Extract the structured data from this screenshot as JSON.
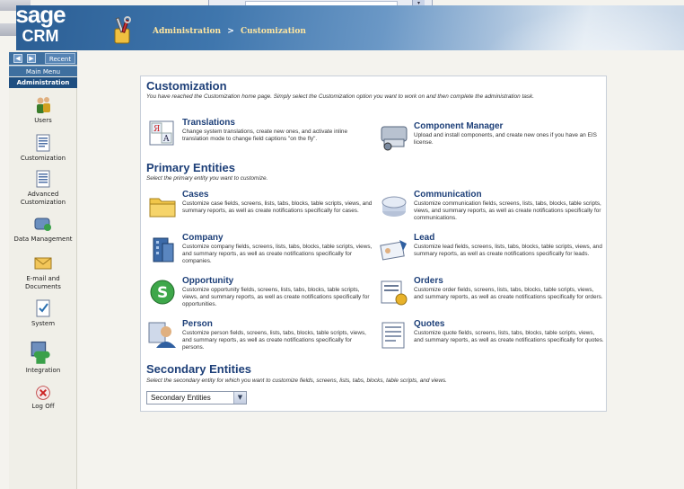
{
  "app": {
    "logo_top": "sage",
    "logo_bottom": "CRM",
    "brand_color": "#2b5e94"
  },
  "breadcrumb": {
    "item1": "Administration",
    "separator": ">",
    "item2": "Customization"
  },
  "sidebar": {
    "back_icon": "left-arrow-icon",
    "forward_icon": "right-arrow-icon",
    "recent_label": "Recent",
    "main_menu_label": "Main Menu",
    "admin_label": "Administration",
    "items": [
      {
        "label": "Users",
        "icon": "users-icon"
      },
      {
        "label": "Customization",
        "icon": "customization-icon"
      },
      {
        "label": "Advanced Customization",
        "icon": "advanced-customization-icon"
      },
      {
        "label": "Data Management",
        "icon": "data-management-icon"
      },
      {
        "label": "E-mail and Documents",
        "icon": "email-icon"
      },
      {
        "label": "System",
        "icon": "system-icon"
      },
      {
        "label": "Integration",
        "icon": "integration-icon"
      },
      {
        "label": "Log Off",
        "icon": "logoff-icon"
      }
    ]
  },
  "customization": {
    "title": "Customization",
    "intro": "You have reached the Customization home page. Simply select the Customization option you want to work on and then complete the administration task.",
    "translations": {
      "title": "Translations",
      "desc": "Change system translations, create new ones, and activate inline translation mode to change field captions \"on the fly\"."
    },
    "component_manager": {
      "title": "Component Manager",
      "desc": "Upload and install components, and create new ones if you have an EIS license."
    }
  },
  "primary": {
    "title": "Primary Entities",
    "intro": "Select the primary entity you want to customize.",
    "entities": [
      {
        "title": "Cases",
        "desc": "Customize case fields, screens, lists, tabs, blocks, table scripts, views, and summary reports, as well as create notifications specifically for cases."
      },
      {
        "title": "Communication",
        "desc": "Customize communication fields, screens, lists, tabs, blocks, table scripts, views, and summary reports, as well as create notifications specifically for communications."
      },
      {
        "title": "Company",
        "desc": "Customize company fields, screens, lists, tabs, blocks, table scripts, views, and summary reports, as well as create notifications specifically for companies."
      },
      {
        "title": "Lead",
        "desc": "Customize lead fields, screens, lists, tabs, blocks, table scripts, views, and summary reports, as well as create notifications specifically for leads."
      },
      {
        "title": "Opportunity",
        "desc": "Customize opportunity fields, screens, lists, tabs, blocks, table scripts, views, and summary reports, as well as create notifications specifically for opportunities."
      },
      {
        "title": "Orders",
        "desc": "Customize order fields, screens, lists, tabs, blocks, table scripts, views, and summary reports, as well as create notifications specifically for orders."
      },
      {
        "title": "Person",
        "desc": "Customize person fields, screens, lists, tabs, blocks, table scripts, views, and summary reports, as well as create notifications specifically for persons."
      },
      {
        "title": "Quotes",
        "desc": "Customize quote fields, screens, lists, tabs, blocks, table scripts, views, and summary reports, as well as create notifications specifically for quotes."
      }
    ]
  },
  "secondary": {
    "title": "Secondary Entities",
    "intro": "Select the secondary entity for which you want to customize fields, screens, lists, tabs, blocks, table scripts, and views.",
    "select_value": "Secondary Entities"
  }
}
